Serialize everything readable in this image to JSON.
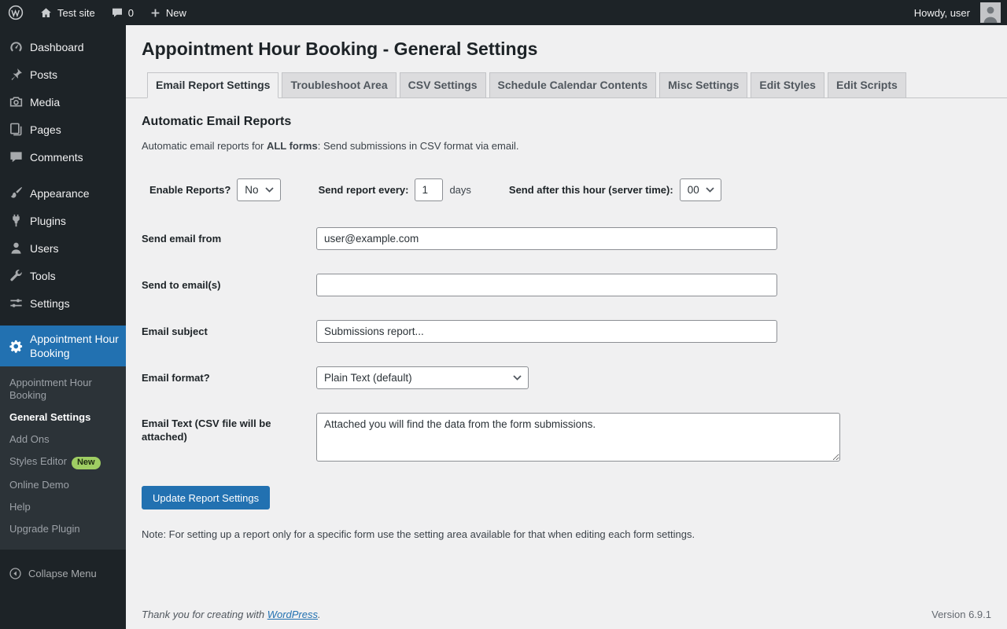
{
  "colors": {
    "accent": "#2271b1",
    "sidebar_bg": "#1d2327",
    "badge_green": "#9fce63"
  },
  "admin_bar": {
    "site_name": "Test site",
    "comments_count": "0",
    "new_label": "New",
    "howdy": "Howdy, user"
  },
  "sidebar": {
    "items": [
      {
        "label": "Dashboard"
      },
      {
        "label": "Posts"
      },
      {
        "label": "Media"
      },
      {
        "label": "Pages"
      },
      {
        "label": "Comments"
      },
      {
        "label": "Appearance"
      },
      {
        "label": "Plugins"
      },
      {
        "label": "Users"
      },
      {
        "label": "Tools"
      },
      {
        "label": "Settings"
      },
      {
        "label": "Appointment Hour Booking"
      }
    ],
    "submenu": [
      {
        "label": "Appointment Hour Booking"
      },
      {
        "label": "General Settings"
      },
      {
        "label": "Add Ons"
      },
      {
        "label": "Styles Editor",
        "badge": "New"
      },
      {
        "label": "Online Demo"
      },
      {
        "label": "Help"
      },
      {
        "label": "Upgrade Plugin"
      }
    ],
    "collapse_label": "Collapse Menu"
  },
  "page": {
    "title": "Appointment Hour Booking - General Settings",
    "tabs": [
      {
        "label": "Email Report Settings"
      },
      {
        "label": "Troubleshoot Area"
      },
      {
        "label": "CSV Settings"
      },
      {
        "label": "Schedule Calendar Contents"
      },
      {
        "label": "Misc Settings"
      },
      {
        "label": "Edit Styles"
      },
      {
        "label": "Edit Scripts"
      }
    ],
    "section_title": "Automatic Email Reports",
    "intro_prefix": "Automatic email reports for ",
    "intro_bold": "ALL forms",
    "intro_suffix": ": Send submissions in CSV format via email.",
    "fields": {
      "enable_label": "Enable Reports?",
      "enable_value": "No",
      "every_label": "Send report every:",
      "every_value": "1",
      "every_suffix": "days",
      "hour_label": "Send after this hour (server time):",
      "hour_value": "00",
      "from_label": "Send email from",
      "from_value": "user@example.com",
      "to_label": "Send to email(s)",
      "to_value": "",
      "subject_label": "Email subject",
      "subject_value": "Submissions report...",
      "format_label": "Email format?",
      "format_value": "Plain Text (default)",
      "text_label": "Email Text (CSV file will be attached)",
      "text_value": "Attached you will find the data from the form submissions."
    },
    "submit_label": "Update Report Settings",
    "note": "Note: For setting up a report only for a specific form use the setting area available for that when editing each form settings."
  },
  "footer": {
    "thanks_prefix": "Thank you for creating with ",
    "thanks_link": "WordPress",
    "thanks_suffix": ".",
    "version": "Version 6.9.1"
  }
}
